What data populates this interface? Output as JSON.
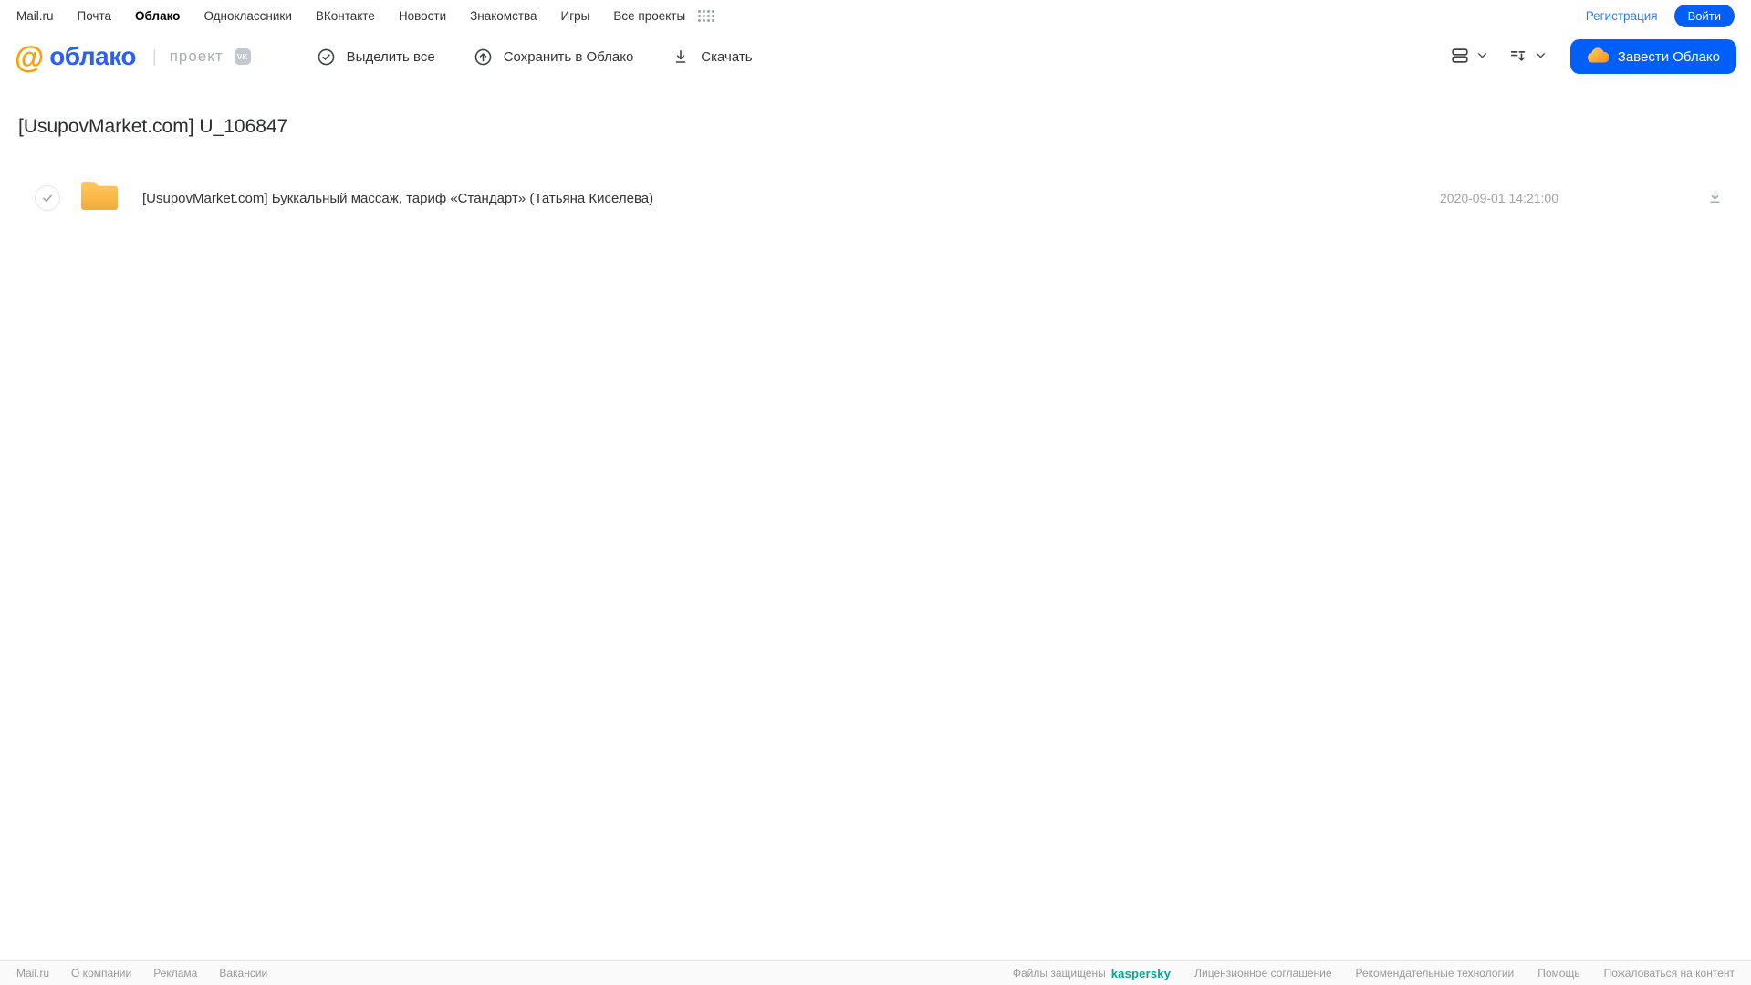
{
  "topnav": {
    "items": [
      "Mail.ru",
      "Почта",
      "Облако",
      "Одноклассники",
      "ВКонтакте",
      "Новости",
      "Знакомства",
      "Игры",
      "Все проекты"
    ],
    "registration_label": "Регистрация",
    "login_label": "Войти"
  },
  "header": {
    "logo_at": "@",
    "logo_text": "облако",
    "project_separator": "|",
    "project_label": "проект",
    "vk_badge": "VK",
    "select_all_label": "Выделить все",
    "save_to_cloud_label": "Сохранить в Облако",
    "download_label": "Скачать",
    "get_cloud_label": "Завести Облако"
  },
  "main": {
    "title": "[UsupovMarket.com] U_106847",
    "files": [
      {
        "name": "[UsupovMarket.com] Буккальный массаж, тариф «Стандарт» (Татьяна Киселева)",
        "date": "2020-09-01 14:21:00"
      }
    ]
  },
  "footer": {
    "links_left": [
      "Mail.ru",
      "О компании",
      "Реклама",
      "Вакансии"
    ],
    "protected_by": "Файлы защищены",
    "kaspersky_label": "kaspersky",
    "links_right": [
      "Лицензионное соглашение",
      "Рекомендательные технологии",
      "Помощь",
      "Пожаловаться на контент"
    ]
  },
  "colors": {
    "accent_blue": "#005ff9",
    "link_blue": "#2b7cf6",
    "logo_orange": "#ff9e00",
    "logo_blue": "#2c5ff6",
    "folder_yellow": "#fbbb43",
    "kaspersky_teal": "#00a88e",
    "text_dark": "#2c2d2e",
    "text_gray": "#9a9a9a"
  }
}
